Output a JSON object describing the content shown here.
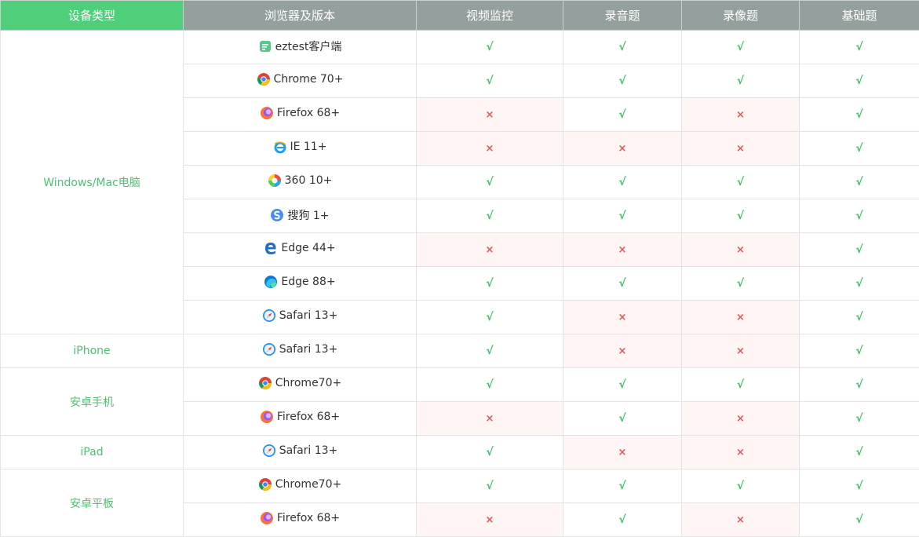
{
  "headers": [
    "设备类型",
    "浏览器及版本",
    "视频监控",
    "录音题",
    "录像题",
    "基础题"
  ],
  "marks": {
    "yes": "√",
    "no": "×"
  },
  "colors": {
    "header_first": "#4fcf7a",
    "header": "#93a09d",
    "device_text": "#4fbf72",
    "yes": "#3bbf63",
    "no": "#e25757",
    "neg_cell_bg": "#fff5f5"
  },
  "groups": [
    {
      "device": "Windows/Mac电脑",
      "rows": [
        {
          "browser": "eztest客户端",
          "icon": "eztest-icon",
          "support": [
            true,
            true,
            true,
            true
          ]
        },
        {
          "browser": "Chrome 70+",
          "icon": "chrome-icon",
          "support": [
            true,
            true,
            true,
            true
          ]
        },
        {
          "browser": "Firefox 68+",
          "icon": "firefox-icon",
          "support": [
            false,
            true,
            false,
            true
          ]
        },
        {
          "browser": "IE 11+",
          "icon": "ie-icon",
          "support": [
            false,
            false,
            false,
            true
          ]
        },
        {
          "browser": "360 10+",
          "icon": "360-icon",
          "support": [
            true,
            true,
            true,
            true
          ]
        },
        {
          "browser": "搜狗 1+",
          "icon": "sogou-icon",
          "support": [
            true,
            true,
            true,
            true
          ]
        },
        {
          "browser": "Edge 44+",
          "icon": "edge-legacy-icon",
          "support": [
            false,
            false,
            false,
            true
          ]
        },
        {
          "browser": "Edge 88+",
          "icon": "edge-icon",
          "support": [
            true,
            true,
            true,
            true
          ]
        },
        {
          "browser": "Safari 13+",
          "icon": "safari-icon",
          "support": [
            true,
            false,
            false,
            true
          ]
        }
      ]
    },
    {
      "device": "iPhone",
      "rows": [
        {
          "browser": "Safari 13+",
          "icon": "safari-icon",
          "support": [
            true,
            false,
            false,
            true
          ]
        }
      ]
    },
    {
      "device": "安卓手机",
      "rows": [
        {
          "browser": "Chrome70+",
          "icon": "chrome-icon",
          "support": [
            true,
            true,
            true,
            true
          ]
        },
        {
          "browser": "Firefox 68+",
          "icon": "firefox-icon",
          "support": [
            false,
            true,
            false,
            true
          ]
        }
      ]
    },
    {
      "device": "iPad",
      "rows": [
        {
          "browser": "Safari 13+",
          "icon": "safari-icon",
          "support": [
            true,
            false,
            false,
            true
          ]
        }
      ]
    },
    {
      "device": "安卓平板",
      "rows": [
        {
          "browser": "Chrome70+",
          "icon": "chrome-icon",
          "support": [
            true,
            true,
            true,
            true
          ]
        },
        {
          "browser": "Firefox 68+",
          "icon": "firefox-icon",
          "support": [
            false,
            true,
            false,
            true
          ]
        }
      ]
    }
  ]
}
